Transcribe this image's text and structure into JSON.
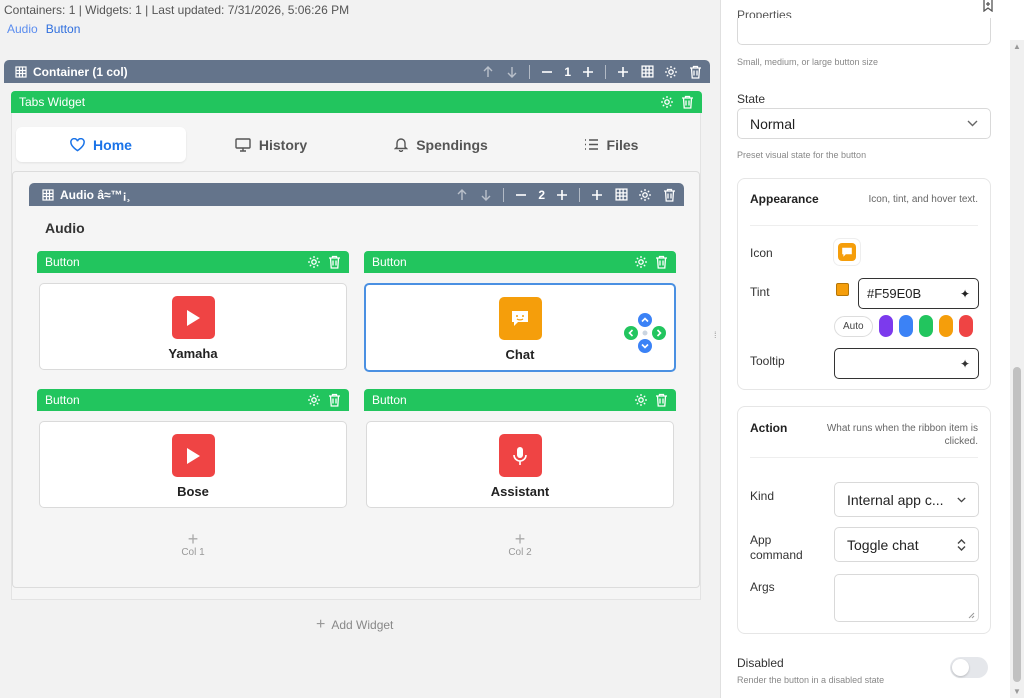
{
  "header": {
    "info": "Containers: 1 | Widgets: 1 | Last updated: 7/31/2026, 5:06:26 PM",
    "breadcrumbs": [
      "Audio",
      "Button"
    ]
  },
  "container": {
    "title": "Container (1 col)",
    "columns": "1"
  },
  "tabs_widget": {
    "title": "Tabs Widget",
    "tabs": [
      {
        "label": "Home",
        "icon": "heart-icon"
      },
      {
        "label": "History",
        "icon": "monitor-icon"
      },
      {
        "label": "Spendings",
        "icon": "bell-icon"
      },
      {
        "label": "Files",
        "icon": "list-icon"
      }
    ]
  },
  "audio_group": {
    "bar_title": "Audio â≈™¡¸",
    "columns": "2",
    "heading": "Audio"
  },
  "buttons": [
    {
      "bar": "Button",
      "label": "Yamaha",
      "icon": "play-icon",
      "color": "#EF4444"
    },
    {
      "bar": "Button",
      "label": "Chat",
      "icon": "chat-icon",
      "color": "#F59E0B"
    },
    {
      "bar": "Button",
      "label": "Bose",
      "icon": "play-icon",
      "color": "#EF4444"
    },
    {
      "bar": "Button",
      "label": "Assistant",
      "icon": "mic-icon",
      "color": "#EF4444"
    }
  ],
  "columns": [
    "Col 1",
    "Col 2"
  ],
  "add_widget": "Add Widget",
  "panel": {
    "title": "Properties",
    "size_hint": "Small, medium, or large button size",
    "state_label": "State",
    "state_value": "Normal",
    "state_hint": "Preset visual state for the button",
    "appearance": {
      "title": "Appearance",
      "subtitle": "Icon, tint, and hover text.",
      "icon_label": "Icon",
      "tint_label": "Tint",
      "tint_value": "#F59E0B",
      "auto_label": "Auto",
      "swatches": [
        "#7C3AED",
        "#3B82F6",
        "#22C55E",
        "#F59E0B",
        "#EF4444"
      ],
      "tooltip_label": "Tooltip",
      "tooltip_value": ""
    },
    "action": {
      "title": "Action",
      "subtitle": "What runs when the ribbon item is clicked.",
      "kind_label": "Kind",
      "kind_value": "Internal app c...",
      "command_label": "App command",
      "command_value": "Toggle chat",
      "args_label": "Args",
      "args_value": ""
    },
    "disabled_label": "Disabled",
    "disabled_hint": "Render the button in a disabled state",
    "disabled_on": false
  },
  "colors": {
    "slate": "#64748B",
    "green": "#22C55E",
    "blue": "#1A73E8"
  }
}
